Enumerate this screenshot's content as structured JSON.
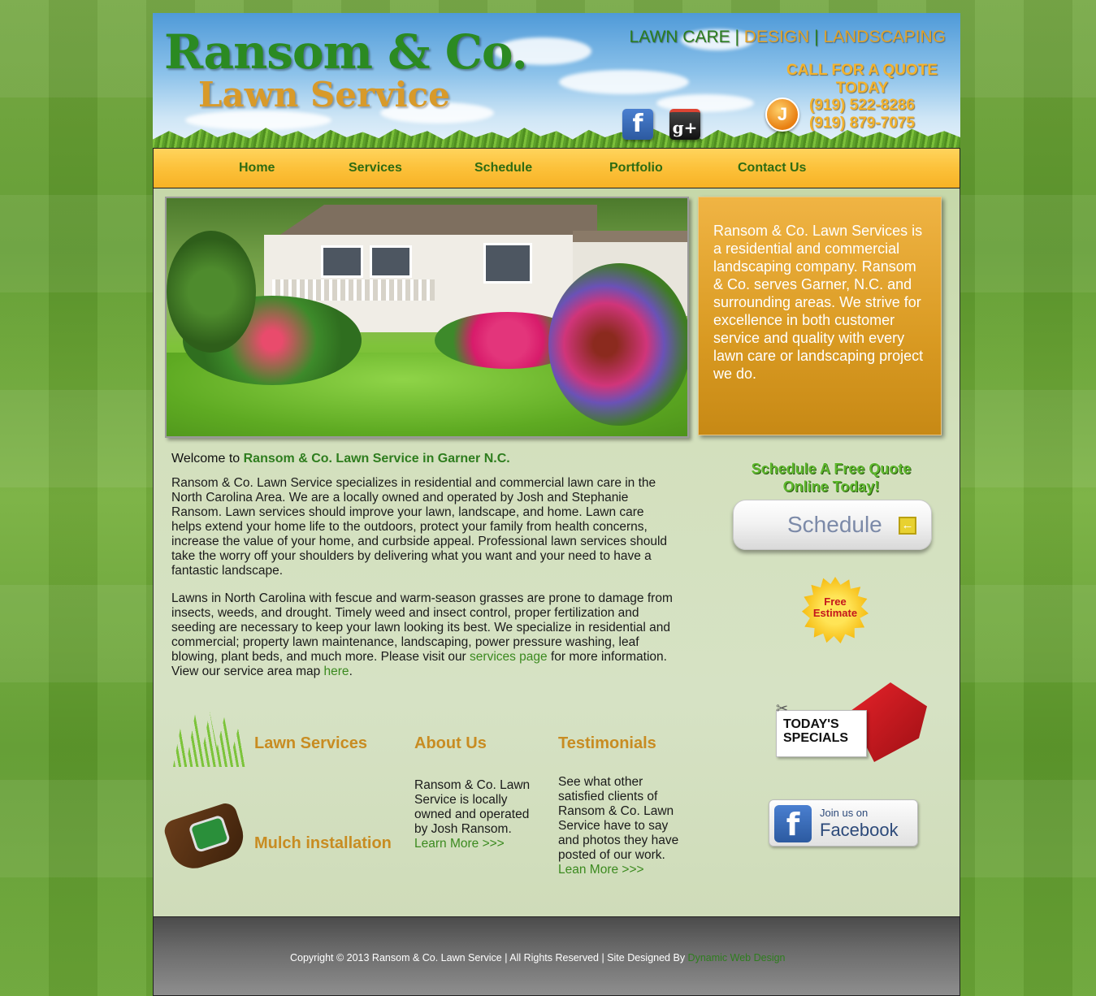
{
  "header": {
    "logo_line1": "Ransom & Co.",
    "logo_line2": "Lawn Service",
    "tagline": {
      "part1": "LAWN CARE",
      "sep1": "|",
      "part2": "DESIGN",
      "sep2": "|",
      "part3": "LANDSCAPING"
    },
    "call_line1": "CALL FOR A QUOTE",
    "call_line2": "TODAY",
    "phone1": "(919) 522-8286",
    "phone2": "(919) 879-7075",
    "facebook_glyph": "f",
    "googleplus_glyph": "g+",
    "phone_icon_glyph": "J"
  },
  "nav": {
    "items": [
      {
        "label": "Home"
      },
      {
        "label": "Services"
      },
      {
        "label": "Schedule"
      },
      {
        "label": "Portfolio"
      },
      {
        "label": "Contact Us"
      }
    ]
  },
  "about_box": {
    "text": "Ransom & Co. Lawn Services is a residential and commercial landscaping company. Ransom & Co. serves Garner, N.C. and surrounding areas. We strive for excellence in both customer service and quality with every lawn care or landscaping project we do."
  },
  "main": {
    "welcome_prefix": "Welcome to ",
    "welcome_bold": "Ransom & Co. Lawn Service in Garner N.C.",
    "intro": "Ransom & Co. Lawn Service specializes in residential and commercial lawn care in the North Carolina Area. We are a locally owned and operated by Josh and Stephanie Ransom. Lawn services should improve your lawn, landscape, and home. Lawn care helps extend your home life to the outdoors, protect your family from health concerns, increase the value of your home, and curbside appeal. Professional lawn services should take the worry off your shoulders by delivering what you want and your need to have a fantastic landscape.",
    "intro2_a": "Lawns in North Carolina with fescue and warm-season grasses are prone to damage from insects, weeds, and drought. Timely weed and insect control, proper fertilization and seeding are necessary to keep your lawn looking its best. We specialize in residential and commercial; property lawn maintenance, landscaping, power pressure washing, leaf blowing, plant beds, and much more. Please visit our ",
    "intro2_link1": "services page",
    "intro2_b": " for more information. View our service area map ",
    "intro2_link2": "here",
    "intro2_c": "."
  },
  "sidebar": {
    "schedule_caption": "Schedule A Free Quote Online Today!",
    "schedule_button": "Schedule",
    "schedule_arrow": "←",
    "free_estimate": "Free Estimate",
    "todays_specials": "TODAY'S SPECIALS",
    "scissors_glyph": "✂",
    "join_us_on": "Join us on",
    "facebook": "Facebook",
    "facebook_glyph": "f"
  },
  "sections": {
    "lawn_services": "Lawn Services",
    "mulch": "Mulch installation",
    "about_title": "About Us",
    "about_text": "Ransom & Co. Lawn Service is locally owned and operated by Josh Ransom.",
    "about_link": "Learn More >>>",
    "testimonials_title": "Testimonials",
    "testimonials_text": "See what other satisfied clients of Ransom & Co. Lawn Service have to say and photos they have posted of our work.",
    "testimonials_link": "Lean More >>>"
  },
  "footer": {
    "copyright": "Copyright © 2013 Ransom & Co. Lawn Service | All Rights Reserved | Site Designed By ",
    "designer": "Dynamic Web Design"
  },
  "colors": {
    "nav_bg": "#fcc13a",
    "nav_text": "#2e6b12",
    "about_box": "#d99a22",
    "heading_orange": "#c88c22",
    "link_green": "#3b8a1f"
  }
}
